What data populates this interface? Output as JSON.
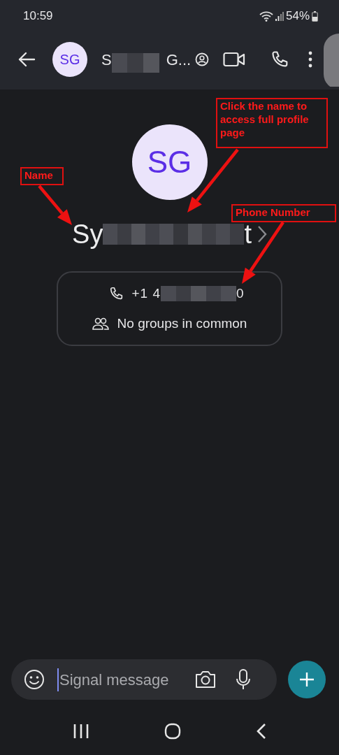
{
  "status_bar": {
    "time": "10:59",
    "battery": "54%"
  },
  "header": {
    "avatar_initials": "SG",
    "name_start": "S",
    "name_end": "G..."
  },
  "profile": {
    "avatar_initials": "SG",
    "name_start": "Sy",
    "name_end": "t",
    "phone_start": "+1 4",
    "phone_end": "0",
    "groups": "No groups in common"
  },
  "composer": {
    "placeholder": "Signal message"
  },
  "annotations": [
    {
      "text": "Click the name to access full profile page"
    },
    {
      "text": "Name"
    },
    {
      "text": "Phone Number"
    }
  ]
}
